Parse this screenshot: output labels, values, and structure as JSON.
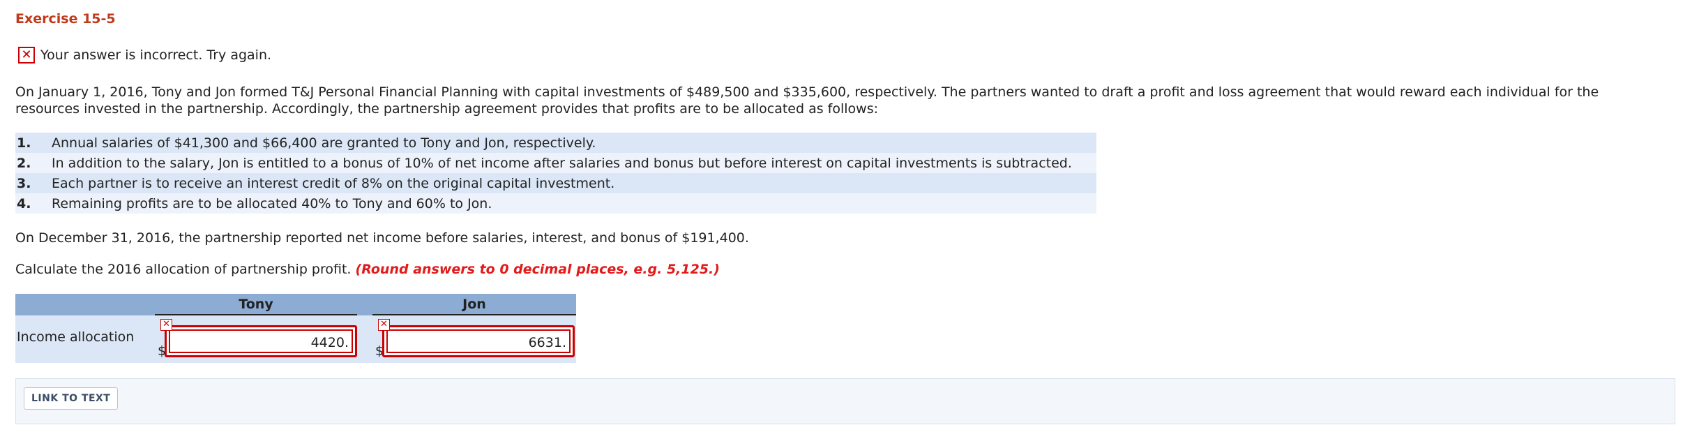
{
  "exercise_title": "Exercise 15-5",
  "feedback": {
    "icon": "x-icon",
    "message": "Your answer is incorrect.  Try again."
  },
  "intro": "On January 1, 2016, Tony and Jon formed T&J Personal Financial Planning with capital investments of $489,500 and $335,600, respectively. The partners wanted to draft a profit and loss agreement that would reward each individual for the resources invested in the partnership. Accordingly, the partnership agreement provides that profits are to be allocated as follows:",
  "rules": [
    {
      "num": "1.",
      "text": "Annual salaries of $41,300 and $66,400 are granted to Tony and Jon, respectively."
    },
    {
      "num": "2.",
      "text": "In addition to the salary, Jon is entitled to a bonus of 10% of net income after salaries and bonus but before interest on capital investments is subtracted."
    },
    {
      "num": "3.",
      "text": "Each partner is to receive an interest credit of 8% on the original capital investment."
    },
    {
      "num": "4.",
      "text": "Remaining profits are to be allocated 40% to Tony and 60% to Jon."
    }
  ],
  "net_income_text": "On December 31, 2016, the partnership reported net income before salaries, interest, and bonus of $191,400.",
  "calculate": {
    "text": "Calculate the 2016 allocation of partnership profit.",
    "note": "(Round answers to 0 decimal places, e.g. 5,125.)"
  },
  "allocation_table": {
    "columns": [
      "Tony",
      "Jon"
    ],
    "row_label": "Income allocation",
    "currency_symbol": "$",
    "values": [
      "4420.",
      "6631."
    ]
  },
  "link_button": "LINK TO TEXT",
  "colors": {
    "title": "#c0391b",
    "error": "#cc0000",
    "note": "#e21a1a",
    "table_header": "#8cacd4",
    "table_body": "#dbe7f6"
  }
}
